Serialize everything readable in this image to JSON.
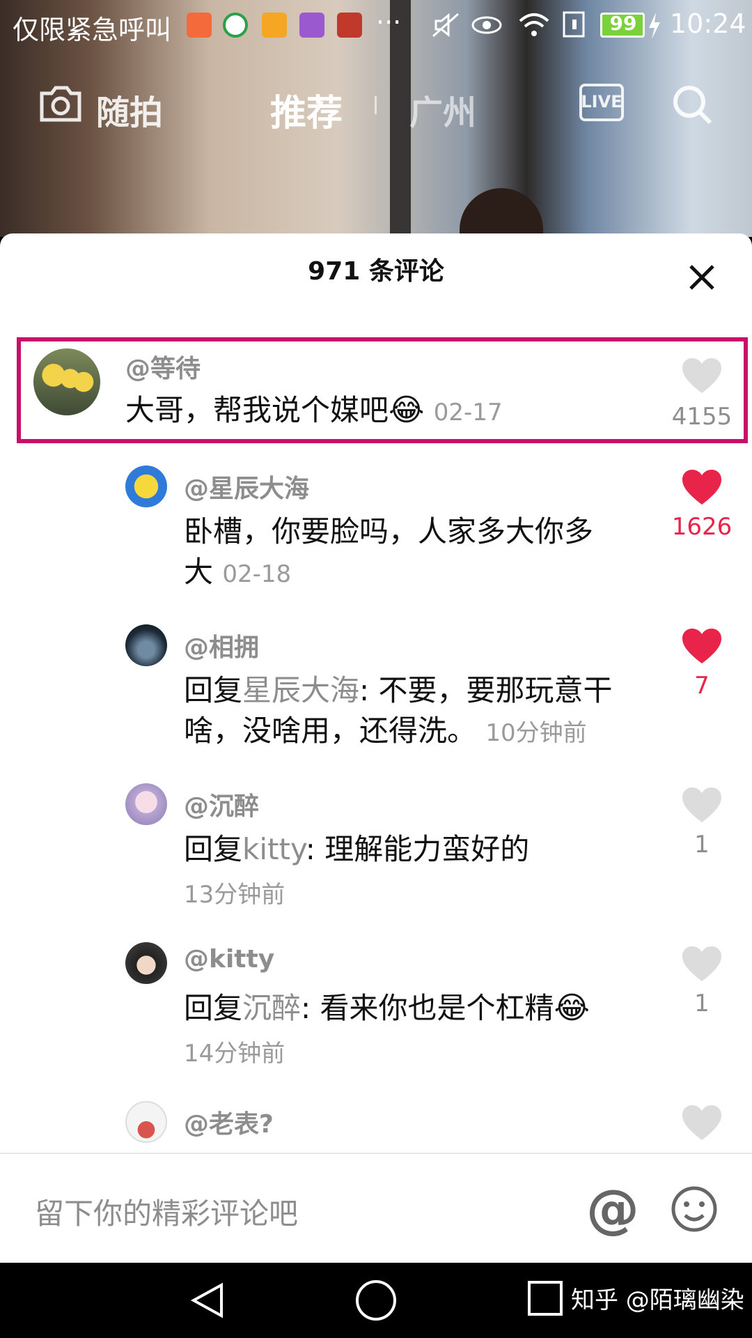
{
  "status_bar": {
    "carrier": "仅限紧急呼叫",
    "battery": "99",
    "time": "10:24",
    "more": "···"
  },
  "top_nav": {
    "camera_label": "随拍",
    "tab_recommend": "推荐",
    "tab_city": "广州",
    "live_icon": "LIVE"
  },
  "comments": {
    "title": "971 条评论",
    "items": [
      {
        "user": "@等待",
        "text": "大哥，帮我说个媒吧",
        "time": "02-17",
        "likes": "4155",
        "liked": false
      },
      {
        "user": "@星辰大海",
        "text": "卧槽，你要脸吗，人家多大你多大",
        "line1": "卧槽，你要脸吗，人家多大你多",
        "line2": "大",
        "time": "02-18",
        "likes": "1626",
        "liked": true
      },
      {
        "user": "@相拥",
        "reply_prefix": "回复",
        "reply_to": "星辰大海",
        "line1_rest": ": 不要，要那玩意干",
        "line2": "啥，没啥用，还得洗。",
        "time": "10分钟前",
        "likes": "7",
        "liked": true
      },
      {
        "user": "@沉醉",
        "reply_prefix": "回复",
        "reply_to": "kitty",
        "text_rest": ": 理解能力蛮好的",
        "time": "13分钟前",
        "likes": "1",
        "liked": false
      },
      {
        "user": "@kitty",
        "reply_prefix": "回复",
        "reply_to": "沉醉",
        "text_rest": ": 看来你也是个杠精",
        "time": "14分钟前",
        "likes": "1",
        "liked": false
      },
      {
        "user": "@老表?",
        "likes": "",
        "liked": false
      }
    ]
  },
  "input": {
    "placeholder": "留下你的精彩评论吧",
    "at_symbol": "@"
  },
  "watermark": "知乎 @陌璃幽染",
  "colors": {
    "accent": "#e8244a",
    "highlight": "#c8106a",
    "grey_text": "#8d8d8d"
  }
}
